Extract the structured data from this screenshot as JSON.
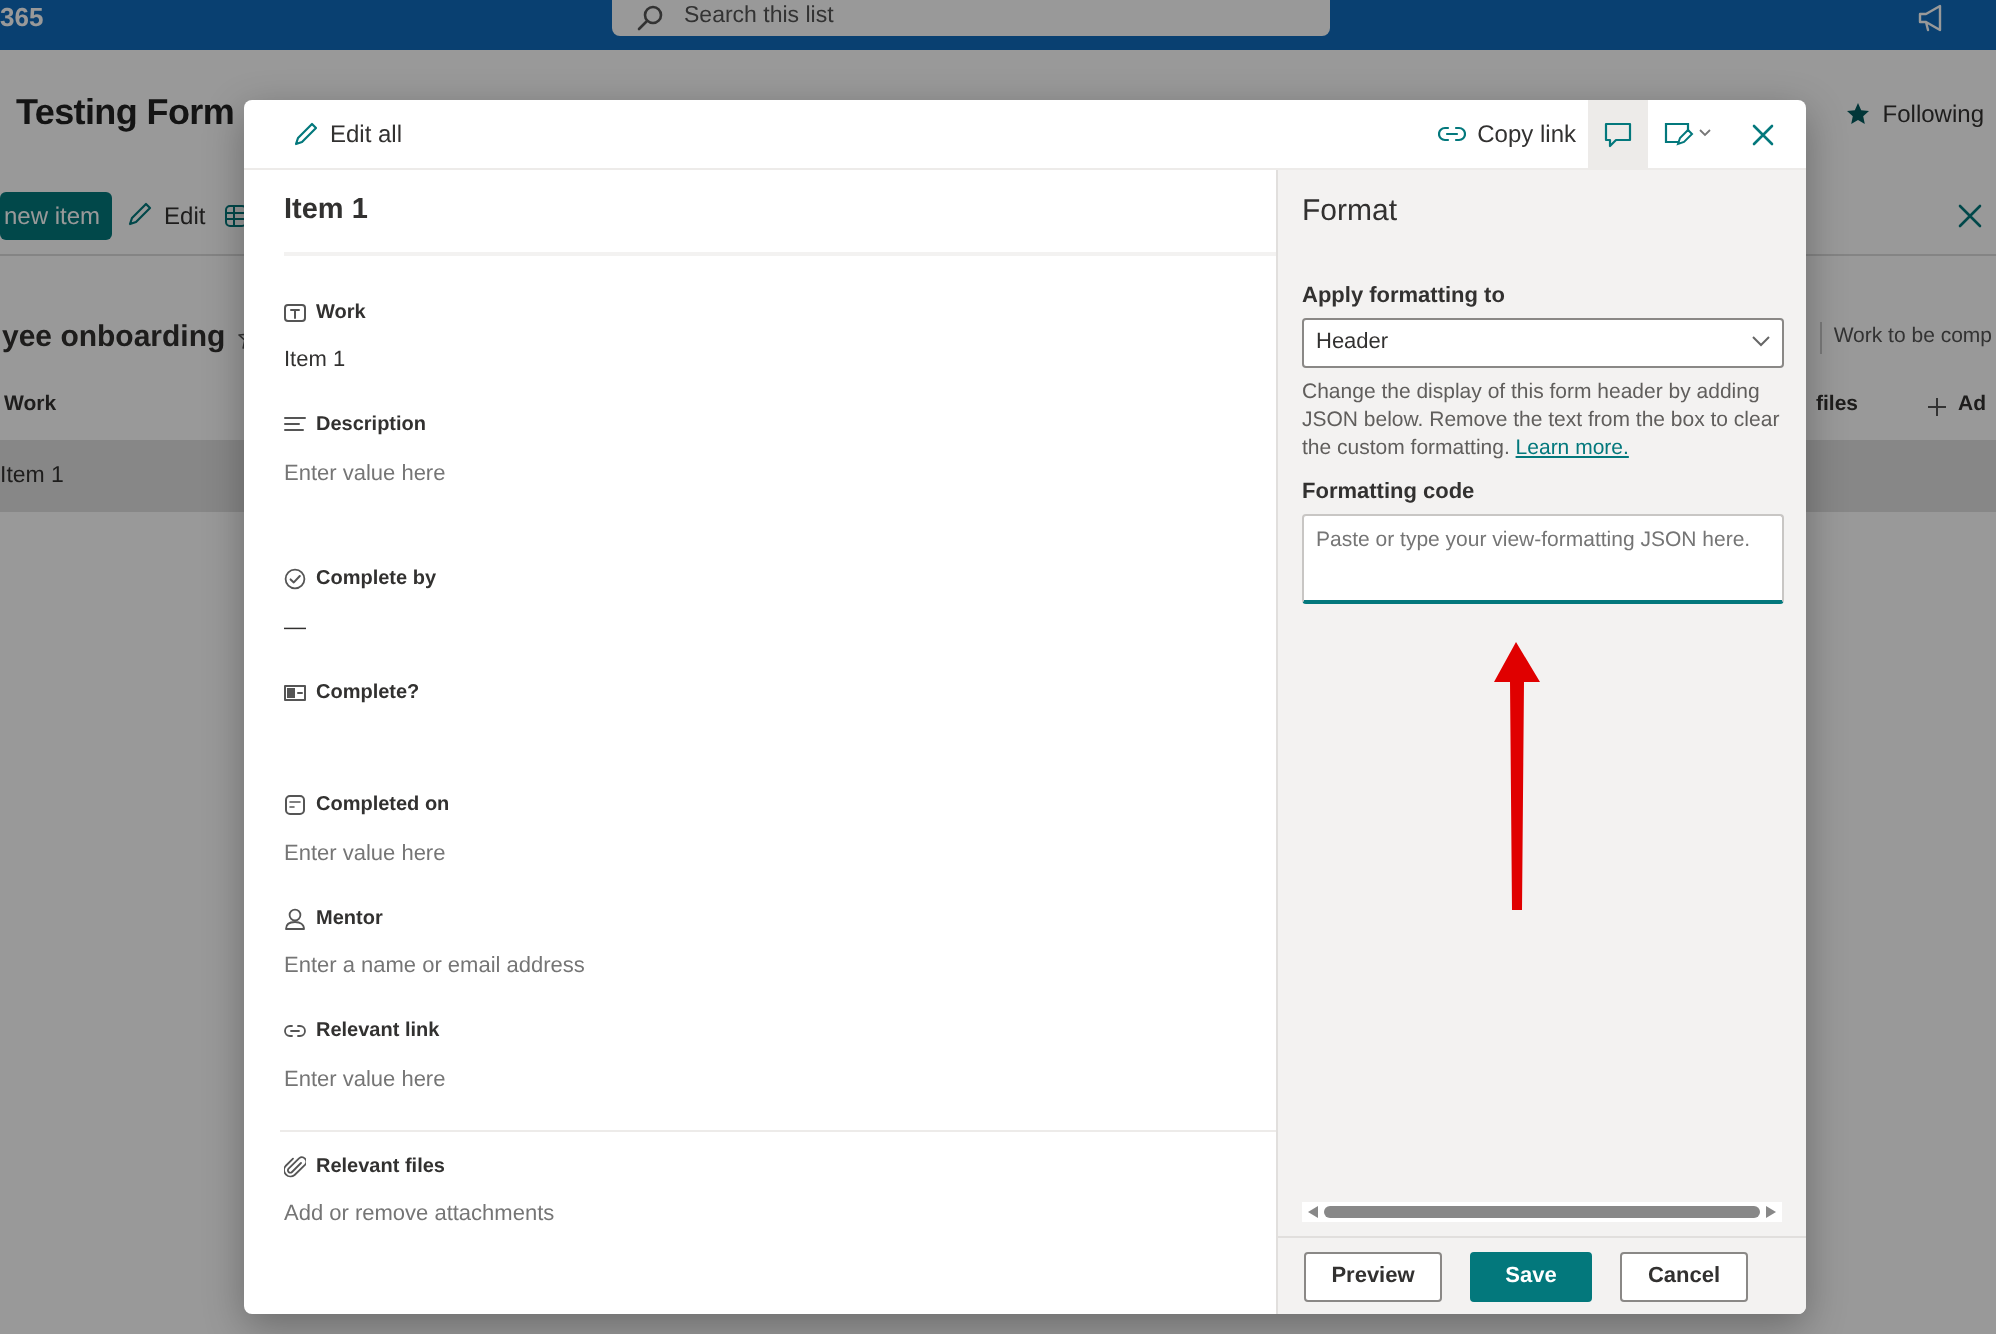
{
  "app_bar": {
    "brand": "365",
    "search_placeholder": "Search this list"
  },
  "list_page": {
    "title": "Testing Form",
    "follow_label": "Following",
    "new_item_label": "new item",
    "edit_label": "Edit",
    "view_name": "yee onboarding",
    "filter_text": "Work to be comp",
    "columns": [
      {
        "label": "Work"
      },
      {
        "label": "files"
      },
      {
        "label": "Ad",
        "kind": "add"
      }
    ],
    "rows": [
      {
        "work": "Item 1",
        "selected": true
      }
    ]
  },
  "dialog": {
    "toolbar": {
      "edit_all": "Edit all",
      "copy_link": "Copy link",
      "comments_selected": true
    },
    "item_title": "Item 1",
    "fields": [
      {
        "kind": "text",
        "label": "Work",
        "value": "Item 1"
      },
      {
        "kind": "note",
        "label": "Description",
        "placeholder": "Enter value here"
      },
      {
        "kind": "choice",
        "label": "Complete by",
        "value": "—"
      },
      {
        "kind": "boolean",
        "label": "Complete?"
      },
      {
        "kind": "date",
        "label": "Completed on",
        "placeholder": "Enter value here"
      },
      {
        "kind": "person",
        "label": "Mentor",
        "placeholder": "Enter a name or email address"
      },
      {
        "kind": "link",
        "label": "Relevant link",
        "placeholder": "Enter value here"
      },
      {
        "kind": "attachments",
        "label": "Relevant files",
        "placeholder": "Add or remove attachments"
      }
    ],
    "format_panel": {
      "title": "Format",
      "apply_label": "Apply formatting to",
      "apply_value": "Header",
      "description": "Change the display of this form header by adding JSON below. Remove the text from the box to clear the custom formatting.",
      "learn_more": "Learn more.",
      "code_label": "Formatting code",
      "code_placeholder": "Paste or type your view-formatting JSON here.",
      "buttons": [
        {
          "label": "Preview",
          "kind": "default"
        },
        {
          "label": "Save",
          "kind": "primary"
        },
        {
          "label": "Cancel",
          "kind": "default"
        }
      ]
    }
  }
}
